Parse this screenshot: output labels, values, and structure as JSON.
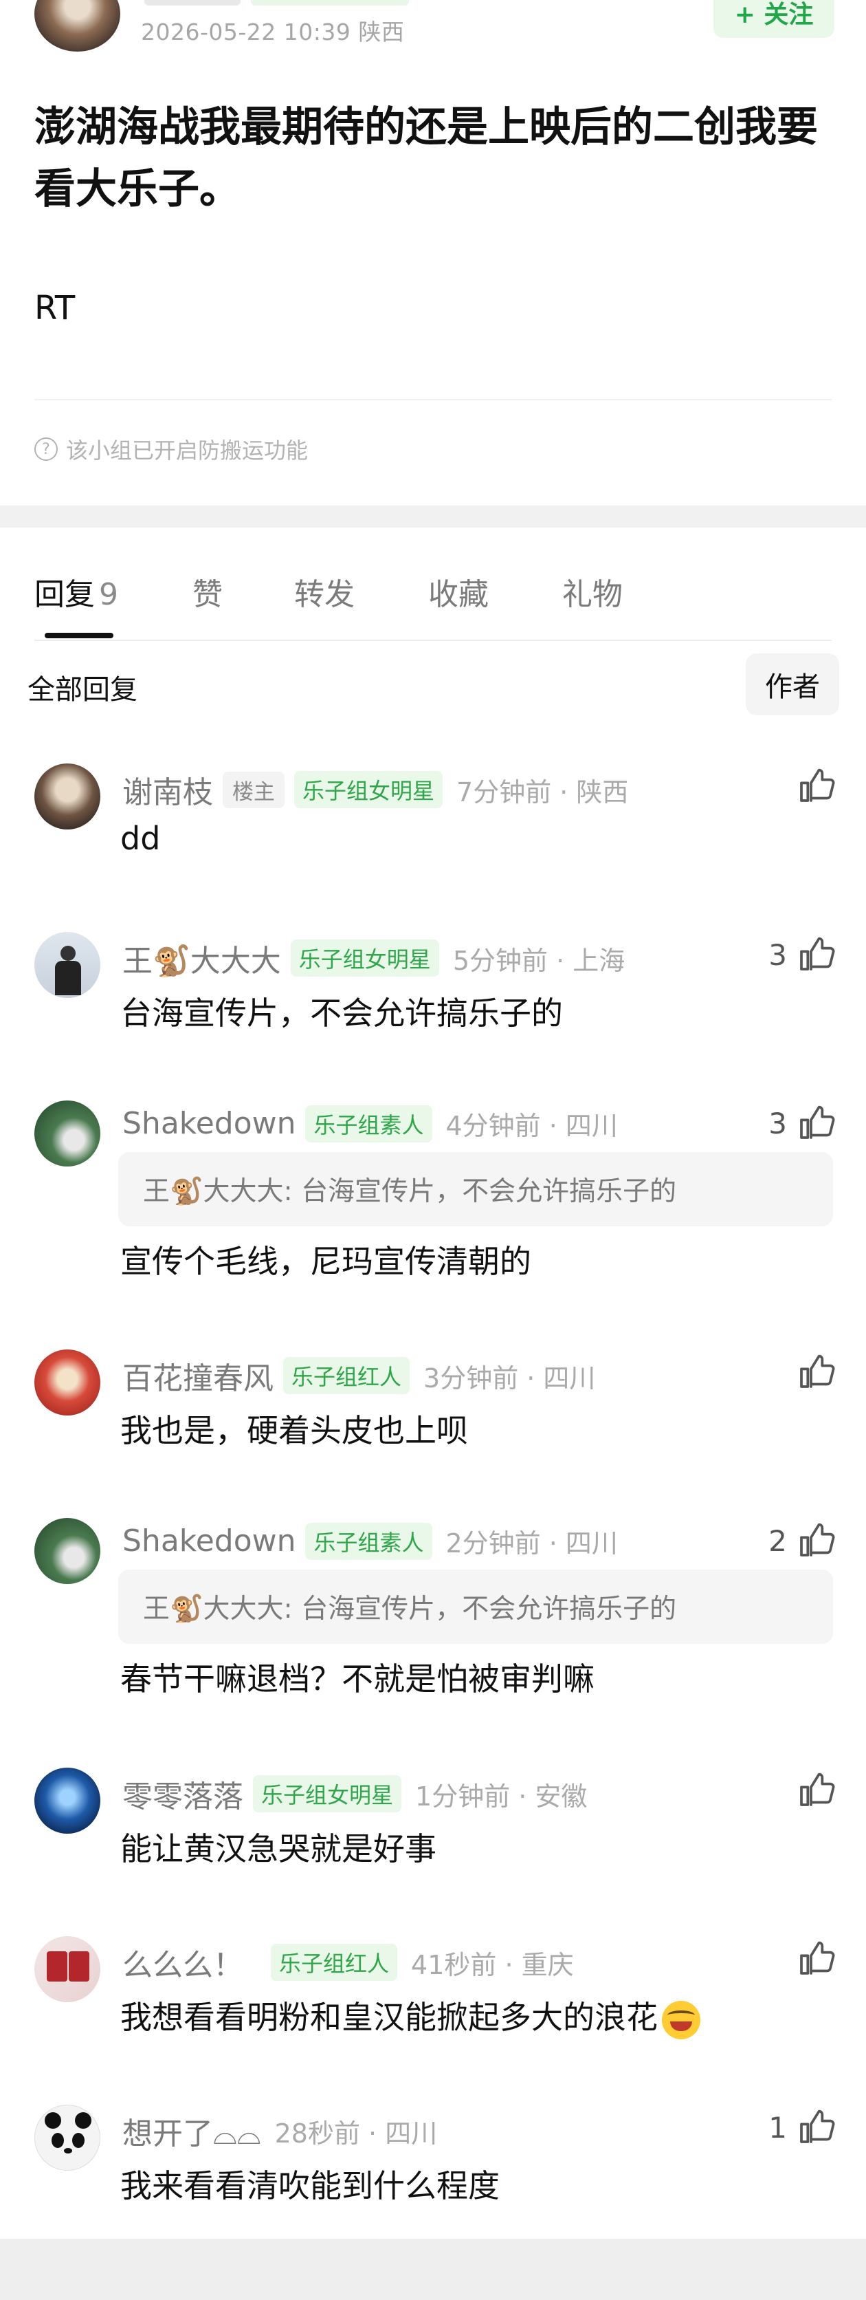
{
  "post": {
    "meta": "2026-05-22 10:39  陕西",
    "follow_label": "+ 关注",
    "title": "澎湖海战我最期待的还是上映后的二创我要看大乐子。",
    "body": "RT",
    "anti_copy_notice": "该小组已开启防搬运功能"
  },
  "tabs": [
    {
      "label": "回复",
      "count": "9"
    },
    {
      "label": "赞"
    },
    {
      "label": "转发"
    },
    {
      "label": "收藏"
    },
    {
      "label": "礼物"
    }
  ],
  "filter": {
    "all_label": "全部回复",
    "author_label": "作者"
  },
  "comments": [
    {
      "name": "谢南枝",
      "op_tag": "楼主",
      "badge": "乐子组女明星",
      "time": "7分钟前 · 陕西",
      "likes": "",
      "text": "dd"
    },
    {
      "name": "王🐒大大大",
      "badge": "乐子组女明星",
      "time": "5分钟前 · 上海",
      "likes": "3",
      "text": "台海宣传片，不会允许搞乐子的"
    },
    {
      "name": "Shakedown",
      "badge": "乐子组素人",
      "time": "4分钟前 · 四川",
      "likes": "3",
      "quote": "王🐒大大大: 台海宣传片，不会允许搞乐子的",
      "text": "宣传个毛线，尼玛宣传清朝的"
    },
    {
      "name": "百花撞春风",
      "badge": "乐子组红人",
      "time": "3分钟前 · 四川",
      "likes": "",
      "text": "我也是，硬着头皮也上呗"
    },
    {
      "name": "Shakedown",
      "badge": "乐子组素人",
      "time": "2分钟前 · 四川",
      "likes": "2",
      "quote": "王🐒大大大: 台海宣传片，不会允许搞乐子的",
      "text": "春节干嘛退档？不就是怕被审判嘛"
    },
    {
      "name": "零零落落",
      "badge": "乐子组女明星",
      "time": "1分钟前 · 安徽",
      "likes": "",
      "text": "能让黄汉急哭就是好事"
    },
    {
      "name": "么么么！",
      "badge": "乐子组红人",
      "time": "41秒前 · 重庆",
      "likes": "",
      "text": "我想看看明粉和皇汉能掀起多大的浪花",
      "emoji": "laughing-crying-emoji"
    },
    {
      "name": "想开了⌓⌓",
      "time": "28秒前 · 四川",
      "likes": "1",
      "text": "我来看看清吹能到什么程度"
    }
  ],
  "colors": {
    "accent_green": "#2fa64a",
    "tag_bg": "#eaf8e9",
    "muted": "#aaaaaa"
  }
}
